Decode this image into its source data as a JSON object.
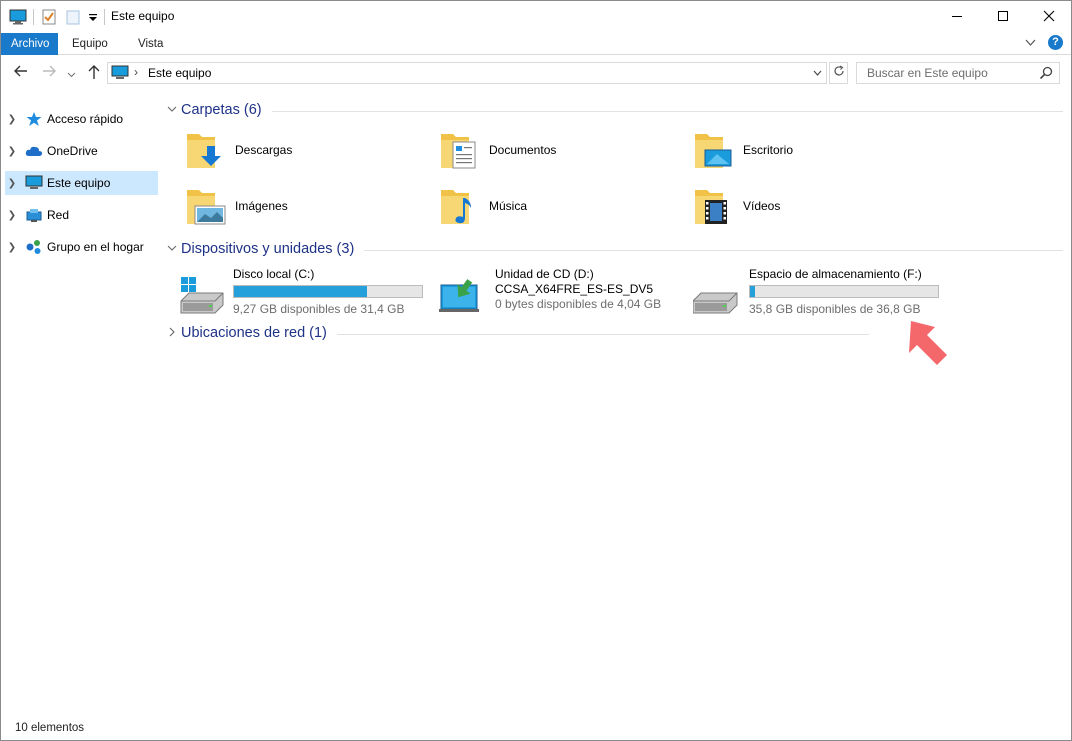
{
  "window": {
    "title": "Este equipo",
    "controls": {
      "minimize": "—",
      "maximize": "☐",
      "close": "✕"
    }
  },
  "ribbon": {
    "tabs": [
      "Archivo",
      "Equipo",
      "Vista"
    ],
    "help": "?",
    "accent_color": "#1979ca"
  },
  "address": {
    "path": "Este equipo",
    "separator": "›",
    "search_placeholder": "Buscar en Este equipo"
  },
  "nav": {
    "items": [
      {
        "label": "Acceso rápido",
        "icon": "star-icon",
        "selected": false
      },
      {
        "label": "OneDrive",
        "icon": "cloud-icon",
        "selected": false
      },
      {
        "label": "Este equipo",
        "icon": "computer-icon",
        "selected": true
      },
      {
        "label": "Red",
        "icon": "network-icon",
        "selected": false
      },
      {
        "label": "Grupo en el hogar",
        "icon": "homegroup-icon",
        "selected": false
      }
    ]
  },
  "groups": {
    "folders": {
      "label": "Carpetas (6)"
    },
    "devices": {
      "label": "Dispositivos y unidades (3)"
    },
    "network": {
      "label": "Ubicaciones de red (1)"
    }
  },
  "folders": [
    {
      "label": "Descargas",
      "icon": "downloads-folder-icon"
    },
    {
      "label": "Documentos",
      "icon": "documents-folder-icon"
    },
    {
      "label": "Escritorio",
      "icon": "desktop-folder-icon"
    },
    {
      "label": "Imágenes",
      "icon": "pictures-folder-icon"
    },
    {
      "label": "Música",
      "icon": "music-folder-icon"
    },
    {
      "label": "Vídeos",
      "icon": "videos-folder-icon"
    }
  ],
  "drives": [
    {
      "name": "Disco local (C:)",
      "free": "9,27 GB disponibles de 31,4 GB",
      "used_fraction": 0.705,
      "icon": "windows-drive-icon"
    },
    {
      "name": "Unidad de CD (D:)",
      "label": "CCSA_X64FRE_ES-ES_DV5",
      "free": "0 bytes disponibles de 4,04 GB",
      "icon": "cd-drive-icon"
    },
    {
      "name": "Espacio de almacenamiento (F:)",
      "free": "35,8 GB disponibles de 36,8 GB",
      "used_fraction": 0.027,
      "icon": "storage-drive-icon"
    }
  ],
  "status": {
    "count": "10 elementos"
  }
}
